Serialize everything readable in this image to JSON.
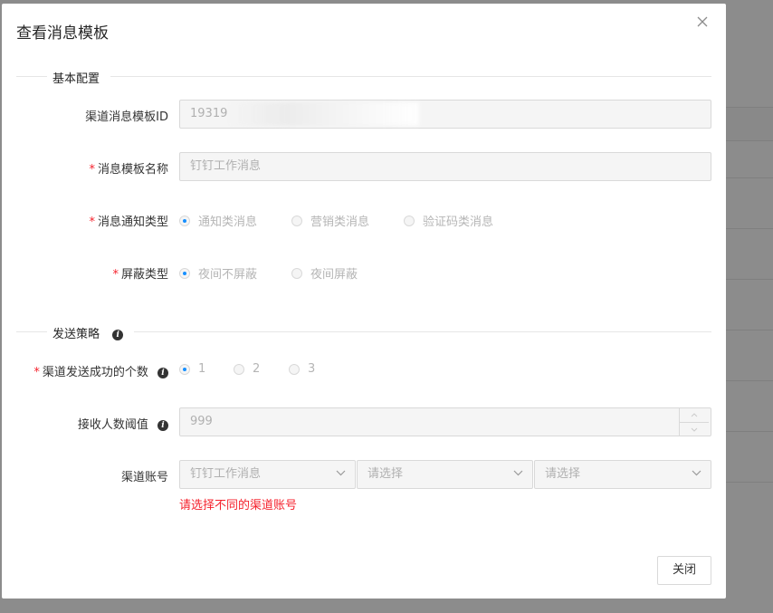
{
  "modal": {
    "title": "查看消息模板",
    "close_button_label": "关闭"
  },
  "sections": {
    "basic": "基本配置",
    "strategy": "发送策略"
  },
  "fields": {
    "template_id": {
      "label": "渠道消息模板ID",
      "value": "19319"
    },
    "template_name": {
      "label": "消息模板名称",
      "value": "钉钉工作消息"
    },
    "notify_type": {
      "label": "消息通知类型",
      "options": [
        "通知类消息",
        "营销类消息",
        "验证码类消息"
      ],
      "selected": "通知类消息"
    },
    "shield_type": {
      "label": "屏蔽类型",
      "options": [
        "夜间不屏蔽",
        "夜间屏蔽"
      ],
      "selected": "夜间不屏蔽"
    },
    "success_count": {
      "label": "渠道发送成功的个数",
      "options": [
        "1",
        "2",
        "3"
      ],
      "selected": "1"
    },
    "receiver_threshold": {
      "label": "接收人数阈值",
      "value": "999"
    },
    "channel_account": {
      "label": "渠道账号",
      "selects": [
        "钉钉工作消息",
        "请选择",
        "请选择"
      ],
      "error": "请选择不同的渠道账号"
    }
  },
  "colors": {
    "accent": "#1890ff",
    "error": "#f5222d",
    "overlay": "rgba(0,0,0,0.45)"
  }
}
